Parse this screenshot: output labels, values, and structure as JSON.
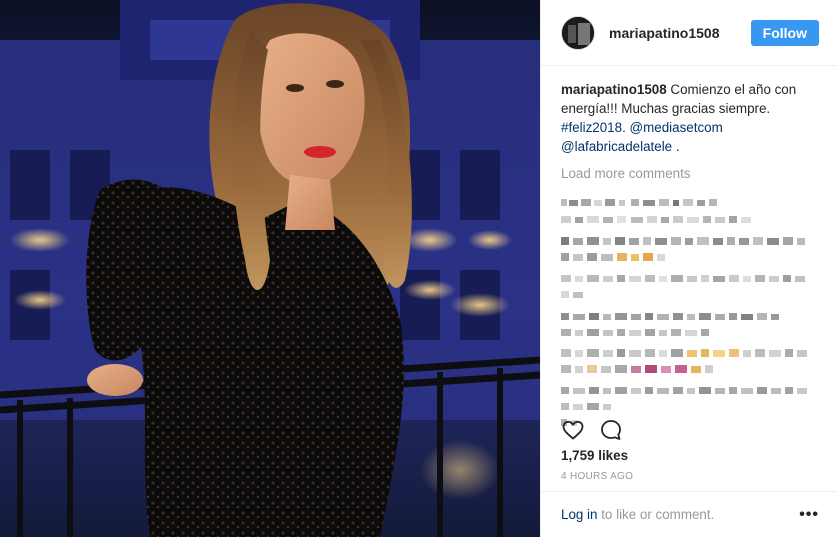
{
  "post": {
    "username": "mariapatino1508",
    "follow_label": "Follow",
    "caption": {
      "user": "mariapatino1508",
      "text": " Comienzo el año con energía!!! Muchas gracias siempre. ",
      "hashtag": "#feliz2018",
      "sep": ". ",
      "mention1": "@mediasetcom",
      "mention2": "@lafabricadelatele",
      "end": " ."
    },
    "load_more": "Load more comments",
    "likes": "1,759 likes",
    "time_ago": "4 HOURS AGO",
    "footer": {
      "login": "Log in",
      "rest": " to like or comment.",
      "more": "•••"
    }
  },
  "icons": [
    "heart-icon",
    "comment-icon",
    "more-options-icon"
  ],
  "colors": {
    "follow_button": "#3897f0",
    "link": "#003569",
    "muted": "#999999",
    "text": "#262626",
    "lipstick": "#d2262c"
  }
}
